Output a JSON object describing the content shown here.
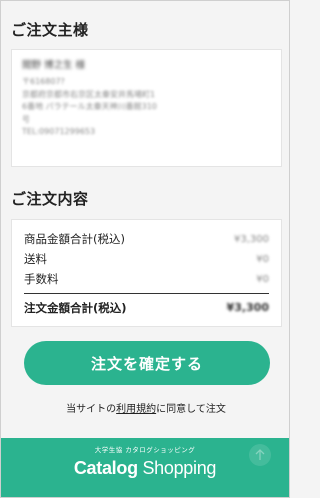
{
  "orderer": {
    "title": "ご注文主様",
    "name": "閲野 博之生 様",
    "lines": [
      "〒616807?",
      "京都府京都市右京区太秦安井馬場町1",
      "6番地 パラテール太秦天神川番館310",
      "号",
      "TEL:09071299653"
    ]
  },
  "order": {
    "title": "ご注文内容",
    "rows": [
      {
        "label": "商品金額合計(税込)",
        "value": "¥3,300"
      },
      {
        "label": "送料",
        "value": "¥0"
      },
      {
        "label": "手数料",
        "value": "¥0"
      }
    ],
    "total": {
      "label": "注文金額合計(税込)",
      "value": "¥3,300"
    }
  },
  "confirm_button": "注文を確定する",
  "agreement": {
    "prefix": "当サイトの",
    "link": "利用規約",
    "suffix": "に同意して注文"
  },
  "footer": {
    "subtitle": "大学生協 カタログショッピング",
    "logo_bold": "Catalog",
    "logo_regular": " Shopping"
  },
  "colors": {
    "accent": "#2bb38f",
    "background": "#f4f4f4"
  }
}
